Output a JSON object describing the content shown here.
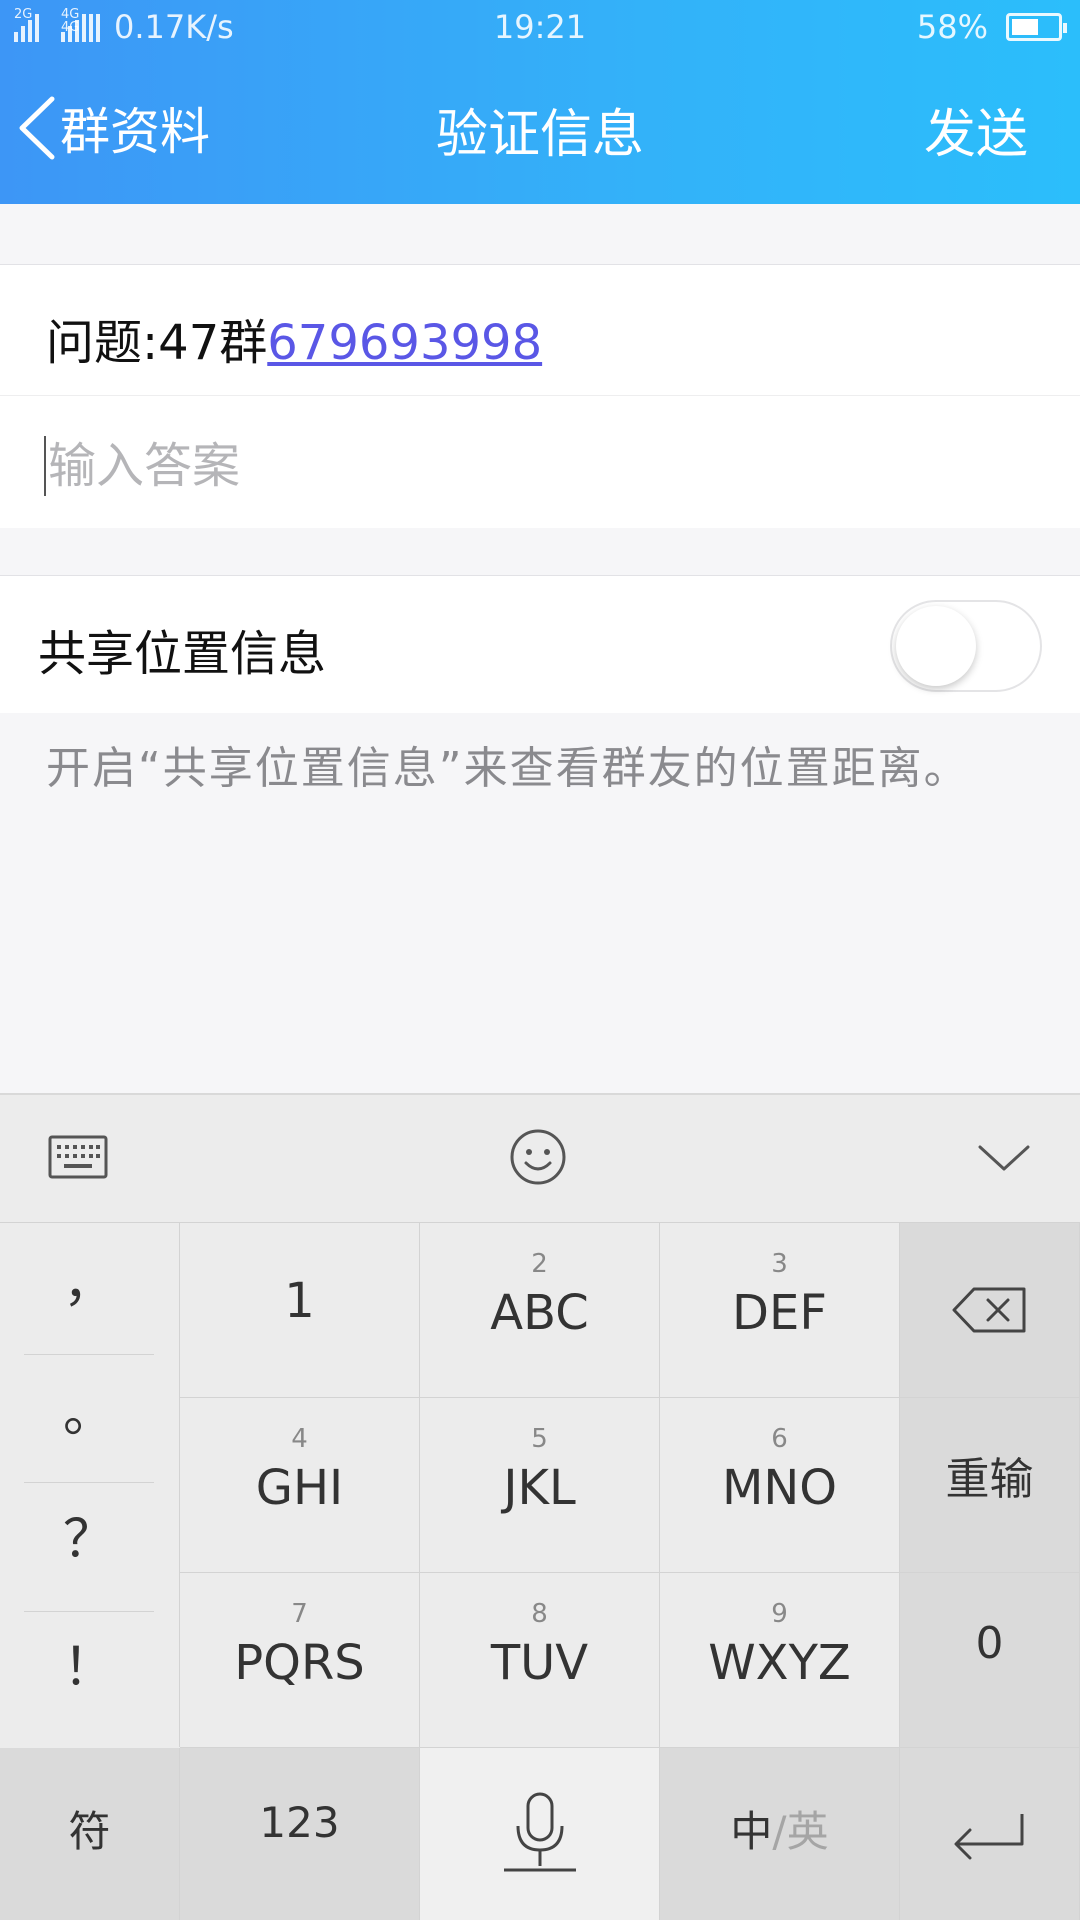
{
  "status_bar": {
    "signal1_tag": "2G",
    "signal2_tag": "4G 4G",
    "net_speed": "0.17K/s",
    "time": "19:21",
    "battery_pct": "58%",
    "battery_level": 0.58
  },
  "nav": {
    "back_label": "群资料",
    "title": "验证信息",
    "send_label": "发送"
  },
  "question": {
    "prefix": "问题:47群",
    "link": "679693998"
  },
  "answer": {
    "placeholder": "输入答案",
    "value": ""
  },
  "share_location": {
    "label": "共享位置信息",
    "enabled": false,
    "hint": "开启“共享位置信息”来查看群友的位置距离。"
  },
  "keyboard": {
    "toolbar_icons": [
      "keyboard-icon",
      "emoji-icon",
      "collapse-icon"
    ],
    "symbols": [
      "，",
      "。",
      "？",
      "！"
    ],
    "keys": [
      {
        "num": "",
        "label": "1"
      },
      {
        "num": "2",
        "label": "ABC"
      },
      {
        "num": "3",
        "label": "DEF"
      },
      {
        "num": "4",
        "label": "GHI"
      },
      {
        "num": "5",
        "label": "JKL"
      },
      {
        "num": "6",
        "label": "MNO"
      },
      {
        "num": "7",
        "label": "PQRS"
      },
      {
        "num": "8",
        "label": "TUV"
      },
      {
        "num": "9",
        "label": "WXYZ"
      }
    ],
    "reinput": "重输",
    "zero": "0",
    "symbol_key": "符",
    "num_key": "123",
    "lang_zh": "中",
    "lang_sep": "/",
    "lang_en": "英"
  }
}
